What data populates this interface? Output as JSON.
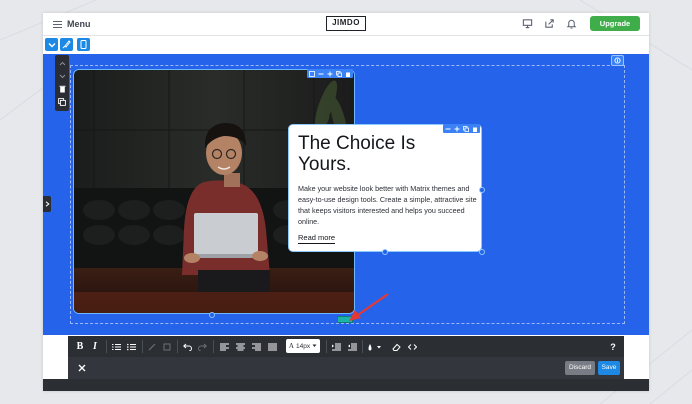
{
  "topbar": {
    "menu_label": "Menu",
    "logo_text": "JIMDO",
    "upgrade_label": "Upgrade",
    "icons": [
      "monitor-icon",
      "share-icon",
      "bell-icon"
    ]
  },
  "subbar": {
    "icons": [
      "chevron-down-icon",
      "brush-icon",
      "mobile-icon"
    ]
  },
  "card": {
    "title": "The Choice Is Yours.",
    "body": "Make your website look better with Matrix themes and easy-to-use design tools. Create a simple, attractive site that keeps visitors interested and helps you succeed online.",
    "link": "Read more"
  },
  "toolbar": {
    "bold": "B",
    "italic": "I",
    "font_size": "14px",
    "help": "?"
  },
  "actions": {
    "discard": "Discard",
    "save": "Save"
  },
  "colors": {
    "hero_background": "#2563eb",
    "upgrade": "#3fae4a",
    "save": "#1e88e5",
    "selection": "#8dc8ff"
  }
}
